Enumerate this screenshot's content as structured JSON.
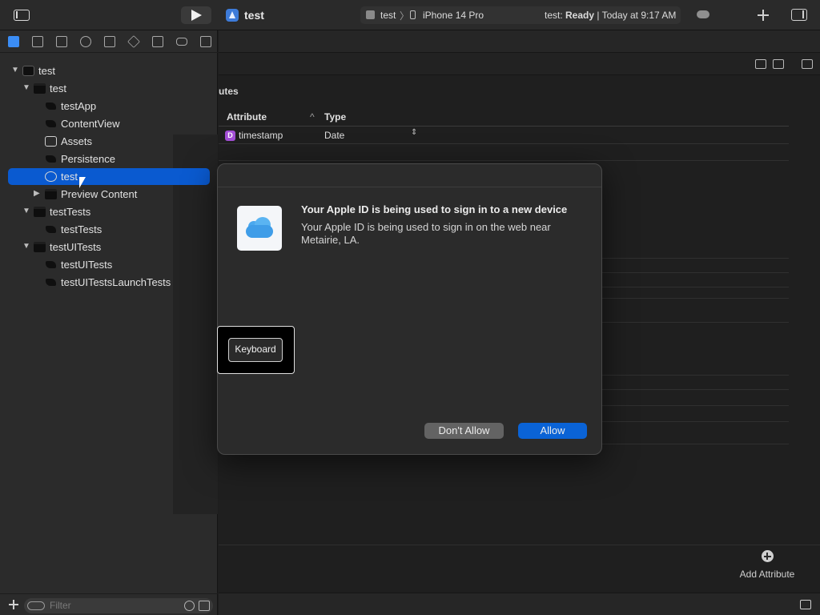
{
  "toolbar": {
    "project_title": "test",
    "scheme_target": "test",
    "scheme_separator": "〉",
    "scheme_device": "iPhone 14 Pro",
    "status_prefix": "test: ",
    "status_state": "Ready",
    "status_suffix": " | Today at 9:17 AM"
  },
  "navigator": {
    "tree": [
      {
        "label": "test",
        "kind": "project",
        "expanded": true
      },
      {
        "label": "test",
        "kind": "folder",
        "expanded": true
      },
      {
        "label": "testApp",
        "kind": "swift"
      },
      {
        "label": "ContentView",
        "kind": "swift"
      },
      {
        "label": "Assets",
        "kind": "assets"
      },
      {
        "label": "Persistence",
        "kind": "swift"
      },
      {
        "label": "test",
        "kind": "model",
        "selected": true
      },
      {
        "label": "Preview Content",
        "kind": "folder",
        "expanded": false
      },
      {
        "label": "testTests",
        "kind": "folder",
        "expanded": true
      },
      {
        "label": "testTests",
        "kind": "swift"
      },
      {
        "label": "testUITests",
        "kind": "folder",
        "expanded": true
      },
      {
        "label": "testUITests",
        "kind": "swift"
      },
      {
        "label": "testUITestsLaunchTests",
        "kind": "swift"
      }
    ],
    "filter_placeholder": "Filter"
  },
  "editor": {
    "section_title": "utes",
    "columns": {
      "attribute": "Attribute",
      "sort": "^",
      "type": "Type"
    },
    "attributes": [
      {
        "badge": "D",
        "name": "timestamp",
        "type": "Date",
        "stepper": "⇕"
      }
    ],
    "add_attribute_label": "Add Attribute"
  },
  "dialog": {
    "title": "Your Apple ID is being used to sign in to a new device",
    "message": "Your Apple ID is being used to sign in on the web near Metairie, LA.",
    "dont_allow_label": "Don't Allow",
    "allow_label": "Allow"
  },
  "keyboard_overlay": {
    "label": "Keyboard"
  },
  "colors": {
    "accent": "#0a63d6",
    "selection": "#0a5ad0",
    "date_badge": "#a34fd6"
  }
}
